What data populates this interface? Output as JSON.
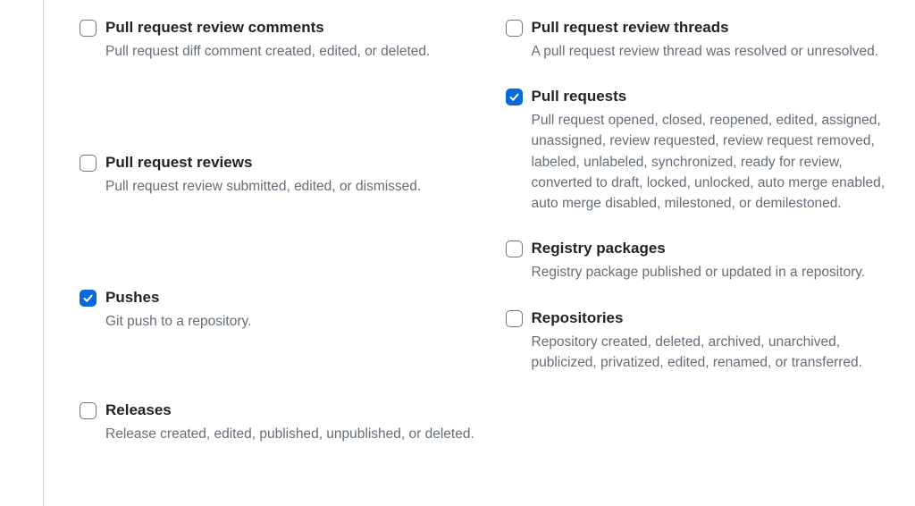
{
  "left_column": [
    {
      "id": "pull-request-review-comments",
      "title": "Pull request review comments",
      "desc": "Pull request diff comment created, edited, or deleted.",
      "checked": false,
      "spacer_after": "large"
    },
    {
      "id": "pull-request-reviews",
      "title": "Pull request reviews",
      "desc": "Pull request review submitted, edited, or dismissed.",
      "checked": false,
      "spacer_after": "large"
    },
    {
      "id": "pushes",
      "title": "Pushes",
      "desc": "Git push to a repository.",
      "checked": true,
      "spacer_after": "medium"
    },
    {
      "id": "releases",
      "title": "Releases",
      "desc": "Release created, edited, published, unpublished, or deleted.",
      "checked": false,
      "spacer_after": "none"
    }
  ],
  "right_column": [
    {
      "id": "pull-request-review-threads",
      "title": "Pull request review threads",
      "desc": "A pull request review thread was resolved or unresolved.",
      "checked": false,
      "spacer_after": "none"
    },
    {
      "id": "pull-requests",
      "title": "Pull requests",
      "desc": "Pull request opened, closed, reopened, edited, assigned, unassigned, review requested, review request removed, labeled, unlabeled, synchronized, ready for review, converted to draft, locked, unlocked, auto merge enabled, auto merge disabled, milestoned, or demilestoned.",
      "checked": true,
      "spacer_after": "none"
    },
    {
      "id": "registry-packages",
      "title": "Registry packages",
      "desc": "Registry package published or updated in a repository.",
      "checked": false,
      "spacer_after": "none"
    },
    {
      "id": "repositories",
      "title": "Repositories",
      "desc": "Repository created, deleted, archived, unarchived, publicized, privatized, edited, renamed, or transferred.",
      "checked": false,
      "spacer_after": "none"
    }
  ]
}
